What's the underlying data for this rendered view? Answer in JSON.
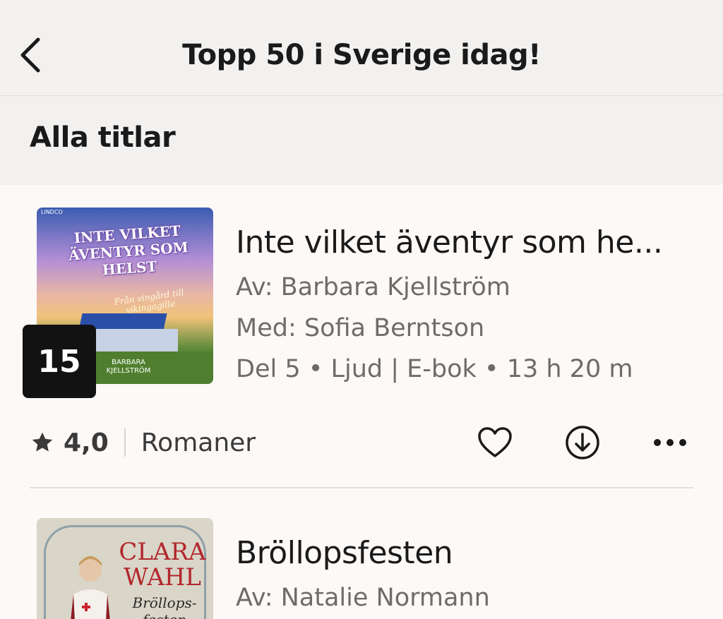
{
  "header": {
    "title": "Topp 50 i Sverige idag!",
    "back_icon": "chevron-left-icon"
  },
  "section": {
    "title": "Alla titlar"
  },
  "items": [
    {
      "rank": "15",
      "title": "Inte vilket äventyr som he...",
      "author": "Av: Barbara Kjellström",
      "narrator": "Med: Sofia Berntson",
      "details": "Del 5 • Ljud | E-bok • 13 h 20 m",
      "rating": "4,0",
      "genre": "Romaner",
      "cover": {
        "publisher": "LINDCO",
        "title": "INTE VILKET ÄVENTYR SOM HELST",
        "subtitle": "Från vingård till vikingagille",
        "author": "BARBARA KJELLSTRÖM"
      }
    },
    {
      "title": "Bröllopsfesten",
      "author": "Av: Natalie Normann",
      "cover": {
        "author": "CLARA WAHL",
        "title": "Bröllops-festen"
      }
    }
  ],
  "icons": {
    "favorite": "heart-icon",
    "download": "download-icon",
    "more": "more-icon",
    "rating": "star-icon"
  },
  "colors": {
    "background": "#fcf9f7",
    "header": "#f2f1f0",
    "text": "#1a1a1a",
    "meta": "#6f6b68",
    "badge": "#121212"
  }
}
